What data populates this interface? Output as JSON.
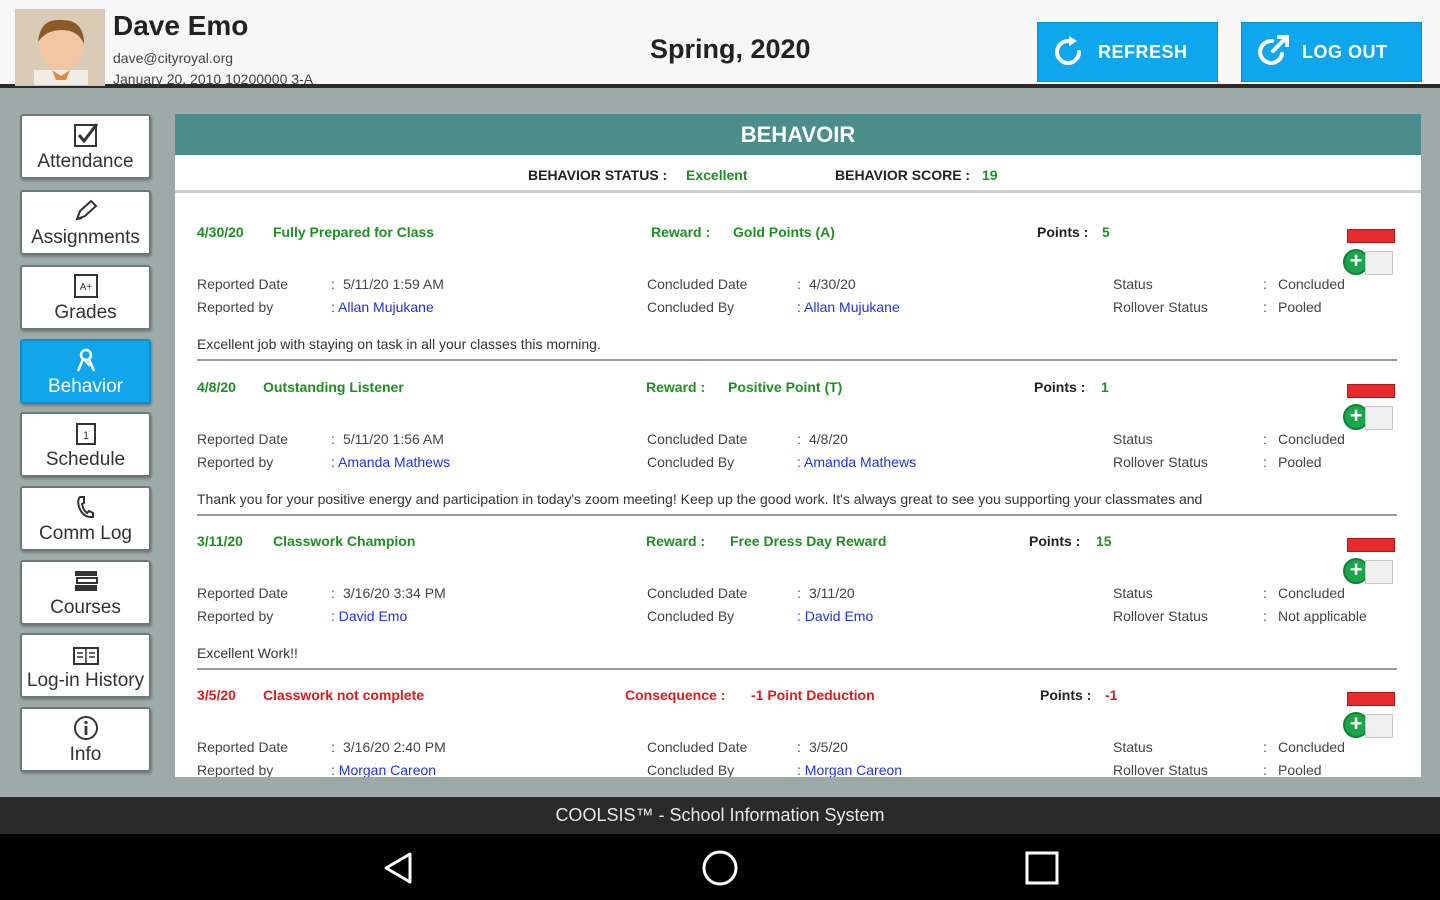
{
  "header": {
    "user_name": "Dave Emo",
    "email": "dave@cityroyal.org",
    "meta": "January 20, 2010 10200000 3-A",
    "term": "Spring, 2020",
    "refresh_label": "REFRESH",
    "logout_label": "LOG OUT"
  },
  "sidebar": {
    "items": [
      {
        "label": "Attendance",
        "icon": "checkbox-icon"
      },
      {
        "label": "Assignments",
        "icon": "pencil-icon"
      },
      {
        "label": "Grades",
        "icon": "grade-icon"
      },
      {
        "label": "Behavior",
        "icon": "ribbon-icon",
        "active": true
      },
      {
        "label": "Schedule",
        "icon": "calendar-icon"
      },
      {
        "label": "Comm Log",
        "icon": "phone-icon"
      },
      {
        "label": "Courses",
        "icon": "books-icon"
      },
      {
        "label": "Log-in History",
        "icon": "log-icon"
      },
      {
        "label": "Info",
        "icon": "info-icon"
      }
    ]
  },
  "panel": {
    "title": "BEHAVOIR",
    "status_label": "BEHAVIOR STATUS :",
    "status_value": "Excellent",
    "score_label": "BEHAVIOR SCORE :",
    "score_value": "19"
  },
  "labels": {
    "reported_date": "Reported Date",
    "reported_by": "Reported by",
    "concluded_date": "Concluded Date",
    "concluded_by": "Concluded By",
    "status": "Status",
    "rollover_status": "Rollover Status",
    "points": "Points :",
    "colon": ":"
  },
  "records": [
    {
      "date": "4/30/20",
      "title": "Fully Prepared for Class",
      "reward_label": "Reward :",
      "reward": "Gold Points (A)",
      "points": "5",
      "reported_date": "5/11/20 1:59 AM",
      "reported_by": "Allan Mujukane",
      "concluded_date": "4/30/20",
      "concluded_by": "Allan Mujukane",
      "status": "Concluded",
      "rollover_status": "Pooled",
      "comment": "Excellent job with staying on task in all your classes this morning.",
      "color": "#1e8f22"
    },
    {
      "date": "4/8/20",
      "title": "Outstanding Listener",
      "reward_label": "Reward :",
      "reward": "Positive Point (T)",
      "points": "1",
      "reported_date": "5/11/20 1:56 AM",
      "reported_by": "Amanda Mathews",
      "concluded_date": "4/8/20",
      "concluded_by": "Amanda Mathews",
      "status": "Concluded",
      "rollover_status": "Pooled",
      "comment": "Thank you for your positive energy and participation in today's zoom meeting! Keep up the good work. It's always great to see you supporting your classmates and",
      "color": "#1e8f22"
    },
    {
      "date": "3/11/20",
      "title": "Classwork Champion",
      "reward_label": "Reward :",
      "reward": "Free Dress Day Reward",
      "points": "15",
      "reported_date": "3/16/20 3:34 PM",
      "reported_by": "David Emo",
      "concluded_date": "3/11/20",
      "concluded_by": "David Emo",
      "status": "Concluded",
      "rollover_status": "Not applicable",
      "comment": "Excellent Work!!",
      "color": "#1e8f22"
    },
    {
      "date": "3/5/20",
      "title": "Classwork not complete",
      "reward_label": "Consequence :",
      "reward": "-1 Point Deduction",
      "points": "-1",
      "reported_date": "3/16/20 2:40 PM",
      "reported_by": "Morgan Careon",
      "concluded_date": "3/5/20",
      "concluded_by": "Morgan Careon",
      "status": "Concluded",
      "rollover_status": "Pooled",
      "comment": "",
      "color": "#e01b1b"
    }
  ],
  "footer": {
    "text": "COOLSIS™ - School Information System"
  },
  "colors": {
    "accent": "#11a6ec",
    "panel_header": "#4a8d8a",
    "positive": "#1e8f22",
    "negative": "#e01b1b",
    "link": "#2233dd"
  }
}
